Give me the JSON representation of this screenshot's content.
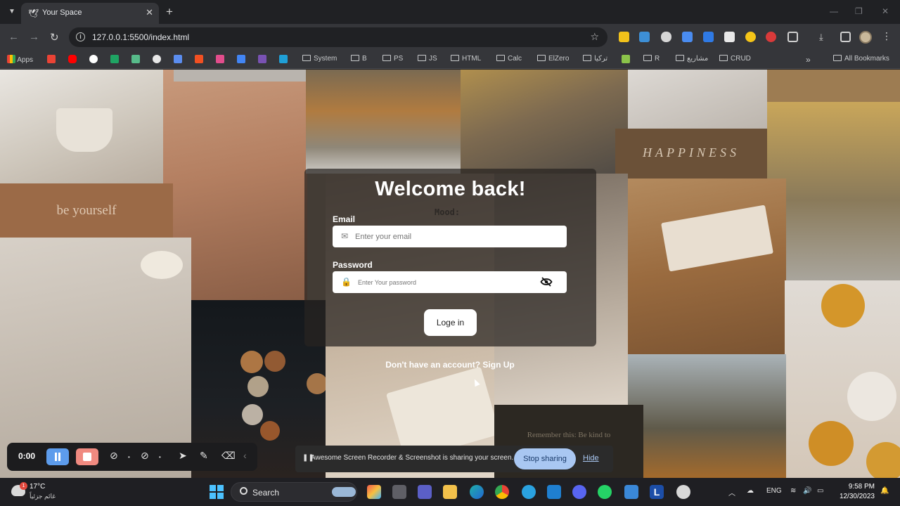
{
  "browser": {
    "tab_title": "Your Space",
    "url": "127.0.0.1:5500/index.html",
    "bookmarks": {
      "apps": "Apps",
      "system": "System",
      "b": "B",
      "ps": "PS",
      "js": "JS",
      "html": "HTML",
      "calc": "Calc",
      "elzero": "ElZero",
      "turkey": "تركيا",
      "r": "R",
      "projects": "مشاريع",
      "crud": "CRUD",
      "all": "All Bookmarks"
    }
  },
  "page": {
    "tile_captions": {
      "be_yourself": "be yourself",
      "happiness": "HAPPINESS",
      "remember": "Remember this: Be kind to"
    },
    "login": {
      "title": "Welcome back!",
      "ghost_text": "Mood:",
      "email_label": "Email",
      "email_placeholder": "Enter your email",
      "password_label": "Password",
      "password_placeholder": "Enter Your password",
      "submit_label": "Loge in",
      "signup_text": "Don't have an account? Sign Up"
    }
  },
  "recorder": {
    "time": "0:00",
    "share_message": "Awesome Screen Recorder & Screenshot is sharing your screen.",
    "stop_label": "Stop sharing",
    "hide_label": "Hide"
  },
  "taskbar": {
    "weather_badge": "1",
    "temperature": "17°C",
    "weather_desc": "غائم جزئياً",
    "search_label": "Search",
    "language": "ENG",
    "time": "9:58 PM",
    "date": "12/30/2023"
  }
}
